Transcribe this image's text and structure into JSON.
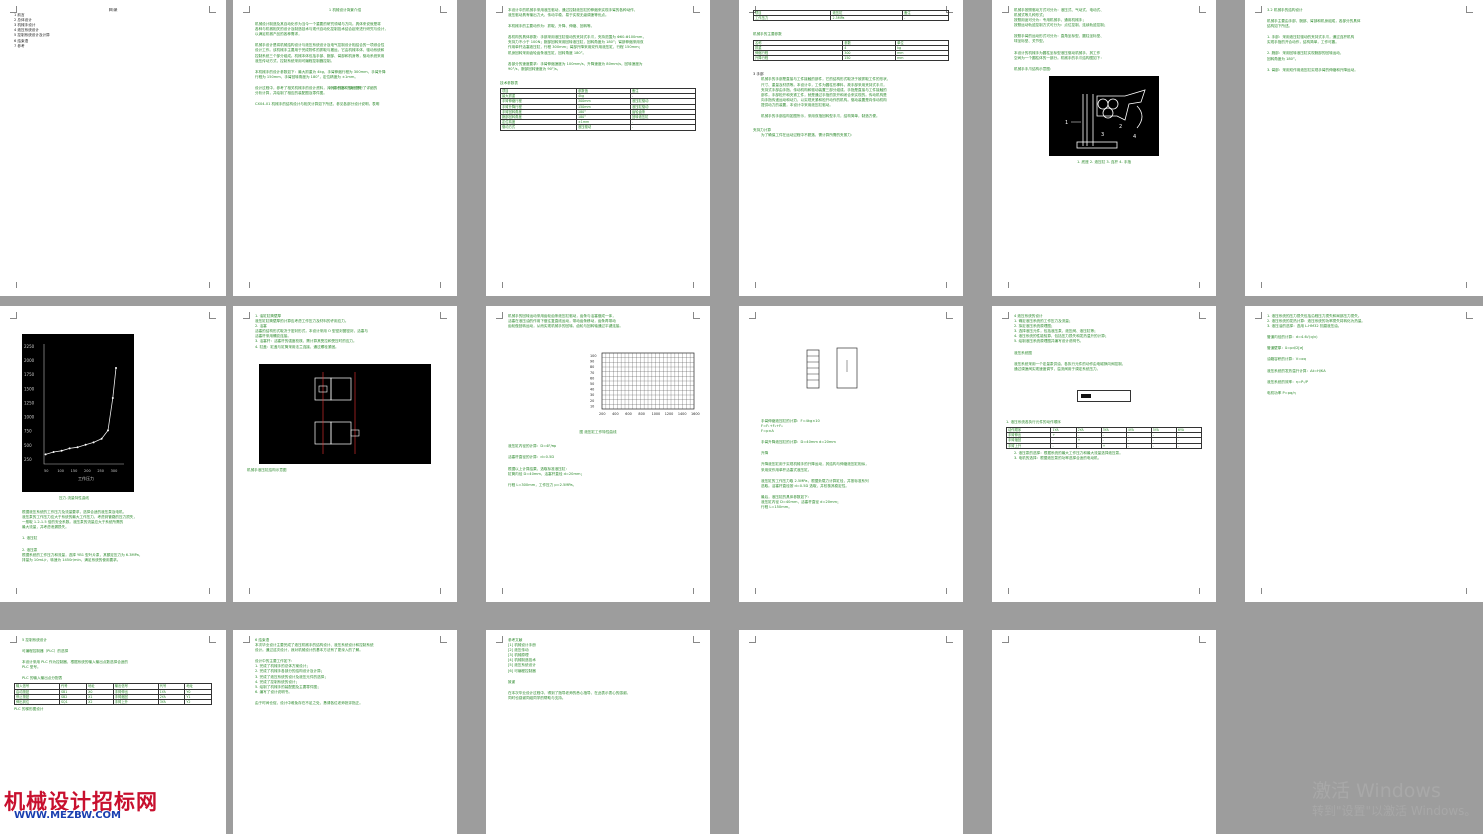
{
  "pages": {
    "p1": {
      "toc_title": "目录",
      "toc_items": [
        "1 前言",
        "2 总体设计",
        "3 机械手设计",
        "4 液压系统设计",
        "5 控制系统设计及计算",
        "6 结束语",
        "7 参考"
      ]
    },
    "p2": {
      "heading1": "1 机械设计背景介绍",
      "heading2": "2 设计总体方案说明",
      "lines": [
        "机械设计制造及其自动化作为当今一个重要的研究领域与方向。具体来说就是将",
        "各种与机械相关的设计及制造技术与现代自动化控制技术结合起来进行研究与设计，",
        "以满足机械产品的各种需求，",
        "",
        "机械手设计是将机械结构设计与液压系统设计及电气控制设计相结合的一项综合性",
        "设计工作。该机械手主要用于完成物件的抓取与搬运，它由机械本体、驱动系统和",
        "控制系统三个部分组成。机械本体包括手部、腕部、臂部和机身等，驱动系统采用",
        "液压传动方式，控制系统采用可编程控制器控制。",
        "",
        "本机械手的设计参数如下：最大抓重为 4kg，手臂伸缩行程为 300mm，手臂升降",
        "行程为 150mm，手臂回转角度为 180°，定位精度为 ±1mm。",
        "",
        "设计过程中，参考了相关机械手的设计资料，对其中的各个部分进行了详细的",
        "分析计算，并绘制了相应的装配图及零件图。",
        "",
        "CX04-01 机械手的结构设计与相关计算如下所述，参见各部分设计说明，表明"
      ]
    },
    "p3": {
      "lines": [
        "本设计中的机械手采用液压驱动，通过控制液压缸的伸缩来实现手臂的各种动作，",
        "液压驱动具有输出力大、传动平稳、易于实现无级调速等优点。",
        "",
        "本机械手的主要动作为：抓取、升降、伸缩、回转等。",
        "",
        "各机构的具体参数：手部采用液压缸驱动的夹持式手爪，夹持范围为 Φ60-Φ100mm，",
        "夹持力不小于 100N；腕部回转采用回转液压缸，回转角度为 180°；臂部伸缩采用双",
        "作用单杆活塞液压缸，行程 300mm；臂部升降采用双作用液压缸，行程 150mm；",
        "机身回转采用齿轮齿条液压缸，回转角度 180°。",
        "",
        "各部分的速度要求：手臂伸缩速度为 100mm/s，升降速度为 80mm/s，回转速度为",
        "90°/s，腕部回转速度为 90°/s。"
      ],
      "table_title": "技术参数表",
      "table_rows": [
        [
          "项目",
          "参数值",
          "备注"
        ],
        [
          "最大抓重",
          "4kg",
          "-"
        ],
        [
          "手臂伸缩行程",
          "300mm",
          "液压缸驱动"
        ],
        [
          "手臂升降行程",
          "150mm",
          "液压缸驱动"
        ],
        [
          "手臂回转角度",
          "180°",
          "齿轮齿条"
        ],
        [
          "腕部回转角度",
          "180°",
          "回转液压缸"
        ],
        [
          "定位精度",
          "±1mm",
          "-"
        ],
        [
          "驱动方式",
          "液压驱动",
          "-"
        ]
      ]
    },
    "p4": {
      "table1_rows": [
        [
          "项目",
          "液压缸",
          "备注"
        ],
        [
          "工作压力",
          "2.5MPa",
          "-"
        ]
      ],
      "section": "机械手的主要参数",
      "table2_rows": [
        [
          "名称",
          "参数",
          "单位"
        ],
        [
          "抓重",
          "4",
          "kg"
        ],
        [
          "伸缩行程",
          "300",
          "mm"
        ],
        [
          "升降行程",
          "150",
          "mm"
        ]
      ],
      "subheading1": "3 手部",
      "lines": [
        "机械手的手部是直接与工件接触的部件，它的结构形式取决于被抓取工件的形状、",
        "尺寸、重量及材质等。本设计中，工件为圆柱形棒料，故手部采用夹持式手爪，",
        "夹持式手部由手指、传动机构和驱动装置三部分组成。手指是直接与工件接触的",
        "部件，手部松开和夹紧工件，就是通过手指的张开和闭合来实现的。传动机构是",
        "向手指传递运动和动力，以实现夹紧和松开动作的机构。驱动装置是向传动机构",
        "提供动力的装置，本设计中采用液压缸驱动。",
        "",
        "机械手的手部结构如图所示，采用双指回转型手爪，结构简单，制造方便。"
      ],
      "subheading2": "夹持力计算",
      "last_line": "为了确保工件在运动过程中不脱落，需计算所需的夹紧力："
    },
    "p5": {
      "lines": [
        "机械手按照驱动方式可分为：液压式、气动式、电动式、",
        "机械式等几种形式；",
        "按照用途可分为：专用机械手、通用机械手；",
        "按照运动轨迹控制方式可分为：点位控制、连续轨迹控制；",
        "",
        "按照手臂的运动形式可分为：直角坐标型、圆柱坐标型、",
        "球坐标型、关节型。",
        "",
        "本设计的机械手为圆柱坐标型液压驱动机械手，其工作",
        "空间为一个圆柱体的一部分。机械手的手爪结构图如下：",
        "",
        "机械手手爪结构示意图："
      ],
      "figure_caption": "1. 底座  2. 液压缸  3. 连杆  4. 手指",
      "fig_labels": [
        "1",
        "2",
        "3",
        "4"
      ]
    },
    "p6": {
      "lines": [
        "3.2 机械手的结构设计",
        "",
        "机械手主要由手部、腕部、臂部和机身组成，各部分的具体",
        "结构如下所述。",
        "",
        "1. 手部：采用液压缸驱动的夹持式手爪，通过连杆机构",
        "实现手指的开合动作，结构简单，工作可靠。",
        "",
        "2. 腕部：采用回转液压缸实现腕部的回转运动，",
        "回转角度为 180°。",
        "",
        "3. 臂部：采用双作用液压缸实现手臂的伸缩和升降运动。"
      ]
    },
    "p7": {
      "chart": {
        "y_ticks": [
          "2250",
          "2000",
          "1750",
          "1500",
          "1250",
          "1000",
          "750",
          "500",
          "250"
        ],
        "x_ticks": [
          "50",
          "100",
          "150",
          "200",
          "250",
          "300"
        ],
        "xlabel": "工作压力",
        "caption": "压力-流量特性曲线"
      },
      "lines": [
        "根据液压系统的工作压力及流量要求，选择合适的液压泵及电机。",
        "液压泵的工作压力应大于系统的最大工作压力，考虑到管路的压力损失，",
        "一般取 1.2-1.5 倍的安全系数。液压泵的流量应大于系统所需的",
        "最大流量，并考虑泄漏损失。",
        "",
        "1. 液压缸",
        "",
        "2. 液压泵",
        "根据系统的工作压力和流量，选择 YB1 型叶片泵，其额定压力为 6.3MPa，",
        "排量为 10mL/r，转速为 1450r/min，满足系统的使用要求。"
      ]
    },
    "p8": {
      "lines": [
        "1. 油缸缸筒壁厚",
        "液压缸缸筒壁厚的计算应考虑工作压力及材料的许用应力。",
        "2. 活塞",
        "活塞的结构形式取决于密封形式，本设计采用 O 型密封圈密封，活塞与",
        "活塞杆采用螺纹连接。",
        "3. 活塞杆：活塞杆的强度校核，需计算其受拉和受压时的应力。",
        "4. 缸盖：缸盖与缸筒采用法兰连接，通过螺栓紧固。"
      ],
      "figure_caption": "机械手液压缸结构示意图"
    },
    "p9": {
      "lines": [
        "机械手的回转运动采用齿轮齿条液压缸驱动，齿条与活塞做成一体，",
        "活塞在液压油的作用下做往复直线运动，带动齿条移动，齿条再带动",
        "齿轮做回转运动，从而实现机械手的回转。齿轮与回转轴通过平键连接。"
      ],
      "graph_caption": "图 液压缸工作特性曲线",
      "graph_x_ticks": [
        "200",
        "400",
        "600",
        "800",
        "1000",
        "1200",
        "1400",
        "1600"
      ],
      "graph_y_ticks": [
        "100",
        "90",
        "80",
        "70",
        "60",
        "50",
        "40",
        "30",
        "20",
        "10"
      ],
      "lines2": [
        "液压缸内径的计算：D=4F/πp",
        "",
        "活塞杆直径的计算：d=0.5D",
        "",
        "根据以上计算结果，选取标准液压缸：",
        "缸筒内径 D=40mm，活塞杆直径 d=20mm；",
        "",
        "行程 L=300mm，工作压力 p=2.5MPa。"
      ]
    },
    "p10": {
      "lines": [
        "手臂伸缩液压缸的计算：F=4kg×10",
        "F=F₁+F₂+F₃",
        "F=p×A",
        "",
        "手臂升降液压缸的计算：D=40mm d=20mm",
        "",
        "升降",
        "",
        "升降液压缸用于实现机械手的升降运动，其结构与伸缩液压缸相似，",
        "采用双作用单杆活塞式液压缸。",
        "",
        "液压缸的工作压力取 2.5MPa，根据负载力计算缸径，并按标准系列",
        "选取。活塞杆直径按 d=0.5D 选取，并校核其稳定性。",
        "",
        "最后，液压缸的具体参数如下：",
        "液压缸内径 D=40mm，活塞杆直径 d=20mm；",
        "行程 L=150mm。"
      ]
    },
    "p11": {
      "lines": [
        "4 液压系统的设计",
        "1. 确定液压系统的工作压力及流量；",
        "2. 拟定液压系统原理图；",
        "3. 选择液压元件，包括液压泵、液压阀、液压缸等；",
        "4. 液压系统的性能验算，包括压力损失和发热温升的计算；",
        "5. 绘制液压系统原理图并编写设计说明书。",
        "",
        "液压系统图",
        "",
        "液压系统采用一个定量泵供油，各执行元件的动作由电磁换向阀控制，",
        "通过调速阀实现速度调节，溢流阀用于调定系统压力。"
      ],
      "table_title": "1. 液压系统各执行元件的动作顺序",
      "table_rows": [
        [
          "动作顺序",
          "1YA",
          "2YA",
          "3YA",
          "4YA",
          "5YA",
          "6YA"
        ],
        [
          "手臂伸出",
          "+",
          "-",
          "-",
          "-",
          "-",
          "-"
        ],
        [
          "手臂缩回",
          "-",
          "+",
          "-",
          "-",
          "-",
          "-"
        ],
        [
          "手臂上升",
          "-",
          "-",
          "+",
          "-",
          "-",
          "-"
        ]
      ],
      "lines2": [
        "2. 液压泵的选择：根据系统的最大工作压力和最大流量选择液压泵。",
        "3. 电机的选择：根据液压泵的功率选择合适的电动机。"
      ]
    },
    "p12": {
      "lines": [
        "1. 液压系统的压力损失包括沿程压力损失和局部压力损失。",
        "2. 液压系统的发热计算：液压系统的功率损失将转化为热量。",
        "3. 液压油的选择：选用 L-HM32 抗磨液压油。",
        "",
        "管道内径的计算：d=4.6√(q/v)",
        "",
        "管道壁厚：δ=pd/2[σ]",
        "",
        "油箱容积的计算：V=αq",
        "",
        "液压系统的发热温升计算：Δt=H/KA",
        "",
        "液压系统的效率：η=P₁/P",
        "",
        "电机功率 P=pq/η"
      ]
    },
    "p13": {
      "lines": [
        "5 控制系统设计",
        "",
        "可编程控制器（PLC）的选择",
        "",
        "本设计采用 PLC 作为控制器，根据系统的输入输出点数选择合适的",
        "PLC 型号。",
        "",
        "PLC 的输入输出点分配表"
      ],
      "table_rows": [
        [
          "输入信号",
          "代号",
          "地址",
          "输出信号",
          "代号",
          "地址"
        ],
        [
          "启动按钮",
          "SB1",
          "X0",
          "手臂伸出",
          "1YA",
          "Y0"
        ],
        [
          "停止按钮",
          "SB2",
          "X1",
          "手臂缩回",
          "2YA",
          "Y1"
        ],
        [
          "伸出到位",
          "SQ1",
          "X2",
          "手臂上升",
          "3YA",
          "Y2"
        ]
      ],
      "footer_line": "PLC 的梯形图设计"
    },
    "p14": {
      "lines": [
        "6 结束语",
        "本次毕业设计主要完成了液压机械手的结构设计、液压系统设计和控制系统",
        "设计。通过这次设计，我对机械设计的基本方法有了更深入的了解。",
        "",
        "设计中的主要工作如下：",
        "1. 完成了机械手的总体方案设计；",
        "2. 完成了机械手各部分的结构设计及计算；",
        "3. 完成了液压系统的设计及液压元件的选择；",
        "4. 完成了控制系统的设计；",
        "5. 绘制了机械手的装配图及主要零件图；",
        "6. 编写了设计说明书。",
        "",
        "由于时间仓促，设计中难免存在不足之处，恳请各位老师批评指正。"
      ]
    },
    "p15": {
      "lines": [
        "参考文献",
        "[1] 机械设计手册",
        "[2] 液压传动",
        "[3] 机械原理",
        "[4] 机械制造技术",
        "[5] 液压系统设计",
        "[6] 可编程控制器",
        "",
        "致谢",
        "",
        "在本次毕业设计过程中，得到了指导老师的悉心指导，在此表示衷心的感谢。",
        "同时也感谢同组同学的帮助与支持。"
      ]
    }
  },
  "watermark": {
    "logo_text": "机械设计招标网",
    "url": "WWW.MEZBW.COM"
  },
  "os_notice": {
    "title": "激活 Windows",
    "subtitle": "转到\"设置\"以激活 Windows。"
  }
}
